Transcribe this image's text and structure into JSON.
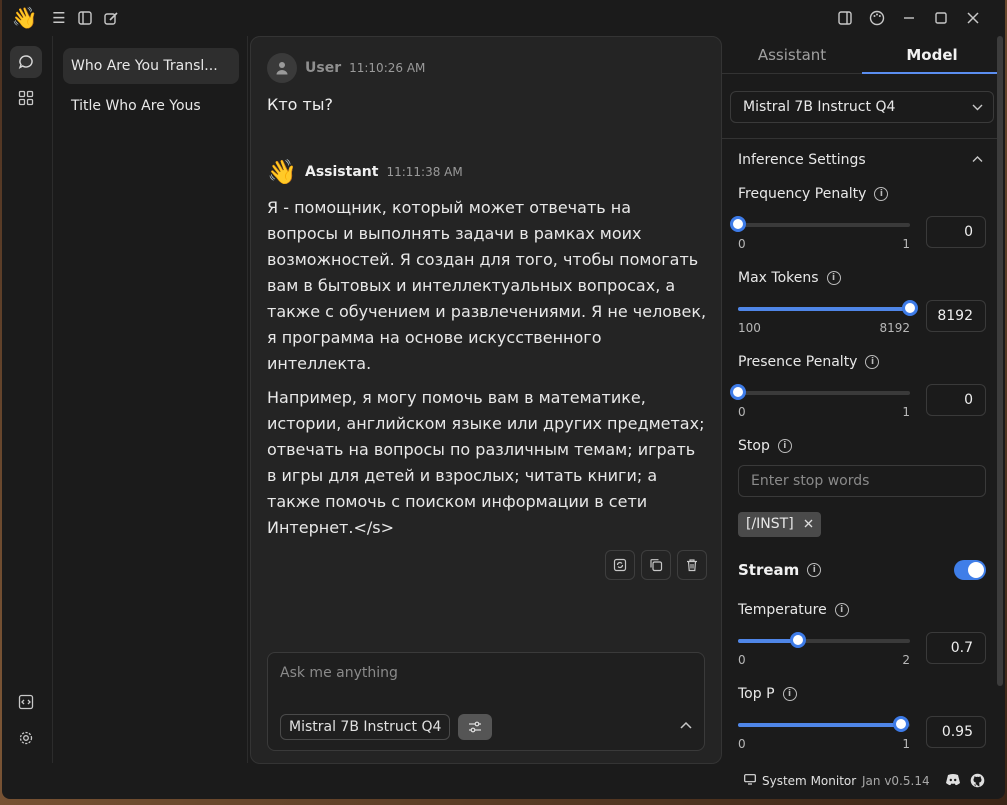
{
  "app": {
    "name": "Jan",
    "version": "Jan v0.5.14"
  },
  "titlebar": {
    "icons": [
      "waving-hand-logo",
      "menu-icon",
      "collapse-sidebar-icon",
      "new-thread-icon",
      "right-panel-icon",
      "palette-icon",
      "minimize-icon",
      "maximize-icon",
      "close-icon"
    ]
  },
  "threads": {
    "items": [
      {
        "label": "Who Are You Transl..."
      },
      {
        "label": "Title Who Are Yous"
      }
    ]
  },
  "chat": {
    "user": {
      "role": "User",
      "time": "11:10:26 AM",
      "text": "Кто ты?"
    },
    "assistant": {
      "role": "Assistant",
      "time": "11:11:38 AM",
      "paragraphs": [
        "Я - помощник, который может отвечать на вопросы и выполнять задачи в рамках моих возможностей. Я создан для того, чтобы помогать вам в бытовых и интеллектуальных вопросах, а также с обучением и развлечениями. Я не человек, я программа на основе искусственного интеллекта.",
        "Например, я могу помочь вам в математике, истории, английском языке или других предметах; отвечать на вопросы по различным темам; играть в игры для детей и взрослых; читать книги; а также помочь с поиском информации в сети Интернет.</s>"
      ]
    },
    "composer": {
      "placeholder": "Ask me anything",
      "model": "Mistral 7B Instruct Q4"
    }
  },
  "right_panel": {
    "tabs": [
      {
        "label": "Assistant",
        "active": false
      },
      {
        "label": "Model",
        "active": true
      }
    ],
    "model_select": "Mistral 7B Instruct Q4",
    "section_title": "Inference Settings",
    "params": {
      "frequency_penalty": {
        "label": "Frequency Penalty",
        "min": "0",
        "max": "1",
        "value": "0",
        "fraction": 0.0
      },
      "max_tokens": {
        "label": "Max Tokens",
        "min": "100",
        "max": "8192",
        "value": "8192",
        "fraction": 1.0
      },
      "presence_penalty": {
        "label": "Presence Penalty",
        "min": "0",
        "max": "1",
        "value": "0",
        "fraction": 0.0
      },
      "temperature": {
        "label": "Temperature",
        "min": "0",
        "max": "2",
        "value": "0.7",
        "fraction": 0.35
      },
      "top_p": {
        "label": "Top P",
        "min": "0",
        "max": "1",
        "value": "0.95",
        "fraction": 0.95
      }
    },
    "stop": {
      "label": "Stop",
      "placeholder": "Enter stop words",
      "tags": [
        "[/INST]"
      ]
    },
    "stream": {
      "label": "Stream",
      "enabled": true
    }
  },
  "footer": {
    "system_monitor": "System Monitor"
  },
  "colors": {
    "accent": "#3d7be8",
    "background": "#1b1b1b",
    "panel": "#242424"
  }
}
